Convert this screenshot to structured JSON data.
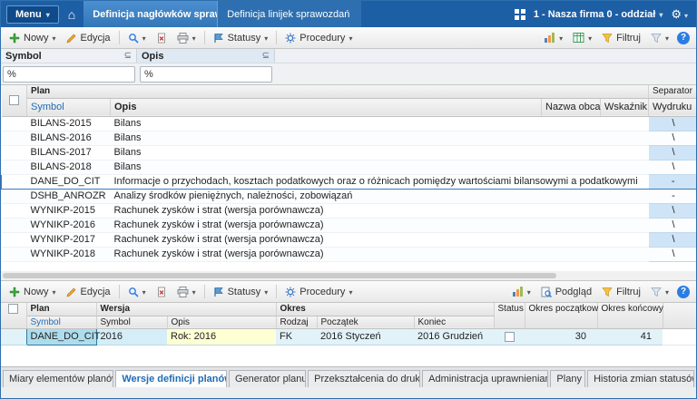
{
  "topbar": {
    "menu_label": "Menu",
    "tabs": [
      {
        "label": "Definicja nagłówków sprawozda"
      },
      {
        "label": "Definicja linijek sprawozdań"
      }
    ],
    "context": "1 - Nasza firma 0 - oddział"
  },
  "toolbar_main": {
    "nowy": "Nowy",
    "edycja": "Edycja",
    "statusy": "Statusy",
    "procedury": "Procedury",
    "filtruj": "Filtruj"
  },
  "filter_panel": {
    "columns": [
      {
        "label": "Symbol",
        "operator": "⊆",
        "value": "%"
      },
      {
        "label": "Opis",
        "operator": "⊆",
        "value": "%"
      }
    ]
  },
  "grid1": {
    "group_plan": "Plan",
    "col_symbol": "Symbol",
    "col_opis": "Opis",
    "col_nazwa_obca": "Nazwa obca",
    "col_wskaznik": "Wskaźnik",
    "col_separator_1": "Separator",
    "col_separator_2": "Wydruku",
    "rows": [
      {
        "symbol": "BILANS-2015",
        "opis": "Bilans",
        "separator": "\\"
      },
      {
        "symbol": "BILANS-2016",
        "opis": "Bilans",
        "separator": "\\"
      },
      {
        "symbol": "BILANS-2017",
        "opis": "Bilans",
        "separator": "\\"
      },
      {
        "symbol": "BILANS-2018",
        "opis": "Bilans",
        "separator": "\\"
      },
      {
        "symbol": "DANE_DO_CIT",
        "opis": "Informacje o przychodach, kosztach podatkowych oraz o różnicach pomiędzy wartościami bilansowymi a podatkowymi",
        "separator": "-"
      },
      {
        "symbol": "DSHB_ANROZR",
        "opis": "Analizy środków pieniężnych, należności, zobowiązań",
        "separator": "-"
      },
      {
        "symbol": "WYNIKP-2015",
        "opis": "Rachunek zysków i strat (wersja porównawcza)",
        "separator": "\\"
      },
      {
        "symbol": "WYNIKP-2016",
        "opis": "Rachunek zysków i strat (wersja porównawcza)",
        "separator": "\\"
      },
      {
        "symbol": "WYNIKP-2017",
        "opis": "Rachunek zysków i strat (wersja porównawcza)",
        "separator": "\\"
      },
      {
        "symbol": "WYNIKP-2018",
        "opis": "Rachunek zysków i strat (wersja porównawcza)",
        "separator": "\\"
      }
    ]
  },
  "toolbar_versions": {
    "nowy": "Nowy",
    "edycja": "Edycja",
    "statusy": "Statusy",
    "procedury": "Procedury",
    "podglad": "Podgląd",
    "filtruj": "Filtruj"
  },
  "grid2": {
    "group_plan": "Plan",
    "group_wersja": "Wersja",
    "group_okres": "Okres",
    "col_plan_symbol": "Symbol",
    "col_wersja_symbol": "Symbol",
    "col_opis": "Opis",
    "col_rodzaj": "Rodzaj",
    "col_poczatek": "Początek",
    "col_koniec": "Koniec",
    "col_status": "Status",
    "col_okres_pocz": "Okres początkow",
    "col_okres_konc": "Okres końcowy",
    "row": {
      "plan_symbol": "DANE_DO_CIT",
      "wersja_symbol": "2016",
      "opis": "Rok: 2016",
      "rodzaj": "FK",
      "poczatek": "2016 Styczeń",
      "koniec": "2016 Grudzień",
      "okres_pocz": "30",
      "okres_konc": "41"
    }
  },
  "bottom_tabs": [
    {
      "label": "Miary elementów planów"
    },
    {
      "label": "Wersje definicji planów"
    },
    {
      "label": "Generator planu"
    },
    {
      "label": "Przekształcenia do druku"
    },
    {
      "label": "Administracja uprawnieniami"
    },
    {
      "label": "Plany"
    },
    {
      "label": "Historia zmian statusów"
    }
  ],
  "colors": {
    "accent_blue": "#1d5fa5",
    "selection_border": "#3b79c0",
    "separator_column": "#cfe4f6",
    "version_row_highlight": "#aedcec",
    "version_opis_highlight": "#ffffd4"
  }
}
